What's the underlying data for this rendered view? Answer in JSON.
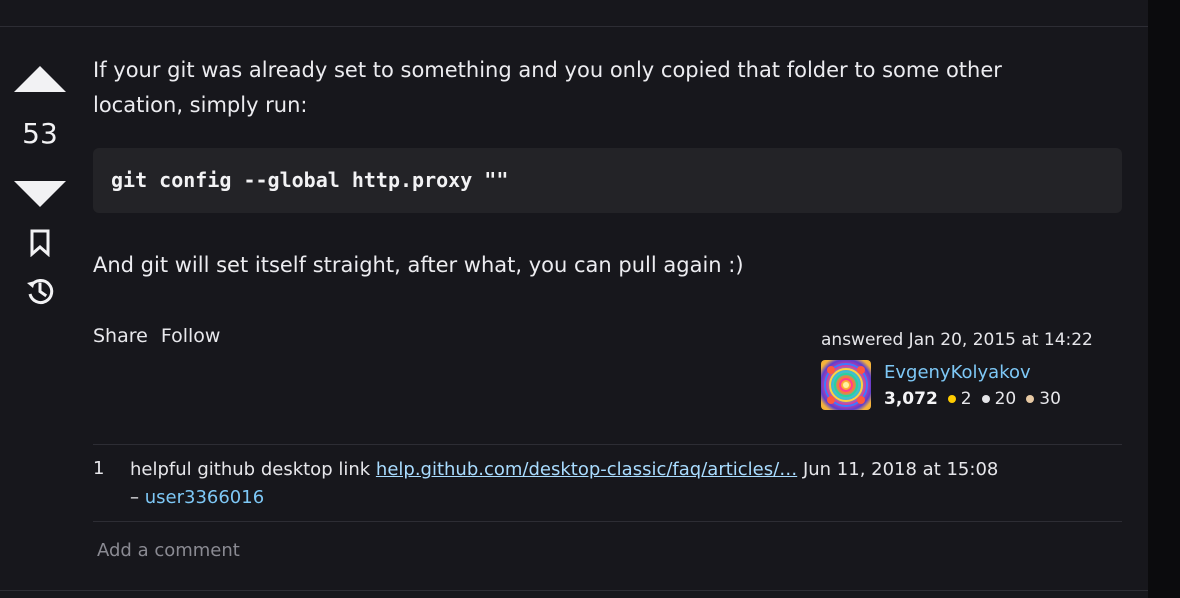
{
  "vote": {
    "count": "53"
  },
  "answer": {
    "paragraph_1": "If your git was already set to something and you only copied that folder to some other location, simply run:",
    "code": "git config --global http.proxy \"\"",
    "paragraph_2": "And git will set itself straight, after what, you can pull again :)"
  },
  "post_menu": {
    "share_label": "Share",
    "follow_label": "Follow"
  },
  "user_card": {
    "answered_text": "answered Jan 20, 2015 at 14:22",
    "user_name": "EvgenyKolyakov",
    "reputation": "3,072",
    "badges": {
      "gold": "2",
      "silver": "20",
      "bronze": "30"
    },
    "badge_colors": {
      "gold": "#ffcc00",
      "silver": "#e4e4e8",
      "bronze": "#e7c9a4"
    }
  },
  "comments": [
    {
      "score": "1",
      "text": "helpful github desktop link ",
      "link_text": "help.github.com/desktop-classic/faq/articles/…",
      "date": "Jun 11, 2018 at 15:08",
      "dash": "– ",
      "user": "user3366016"
    }
  ],
  "add_comment_label": "Add a comment",
  "colors": {
    "background": "#17171c",
    "link": "#7ec8f6",
    "code_bg": "#232327"
  }
}
